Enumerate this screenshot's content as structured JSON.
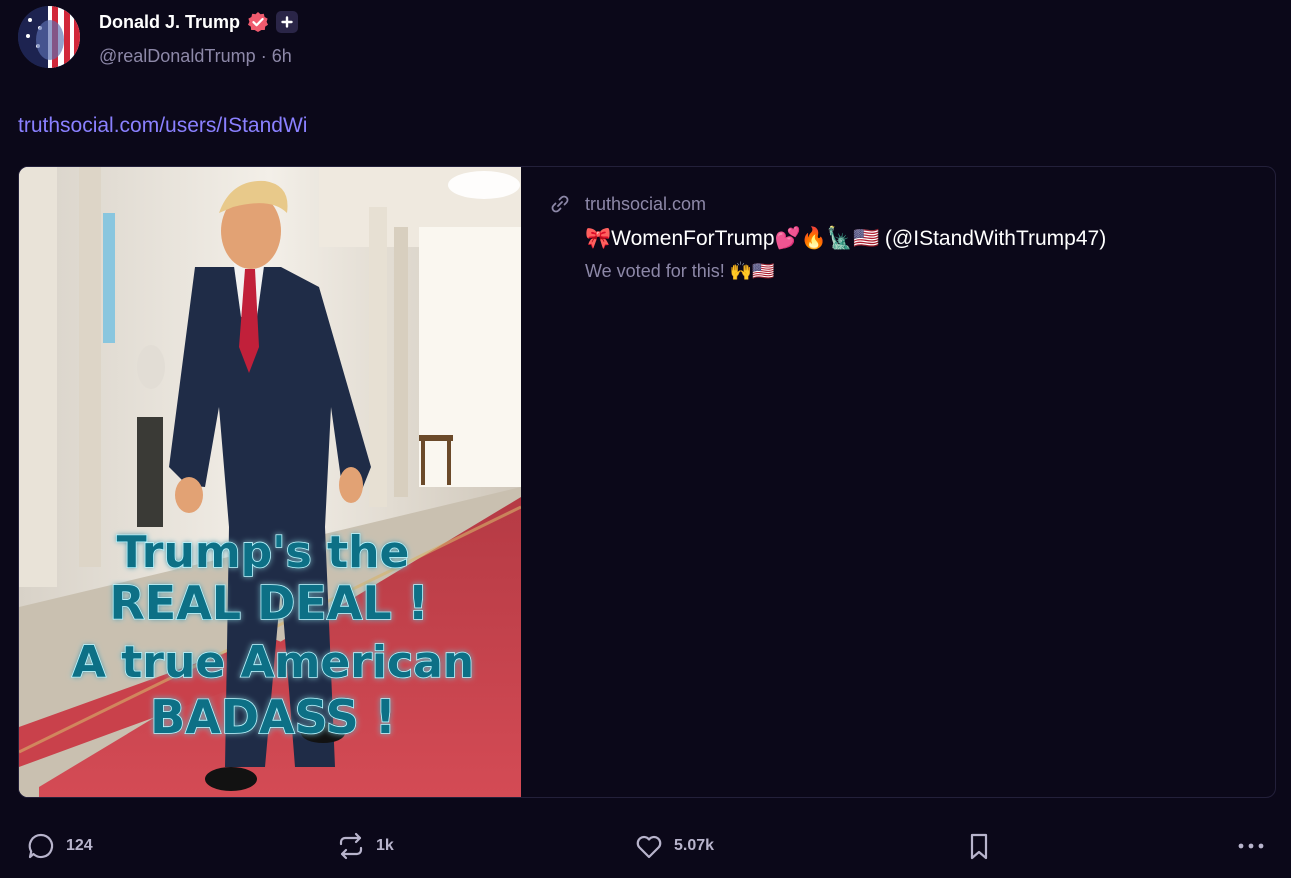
{
  "author": {
    "display_name": "Donald J. Trump",
    "handle": "@realDonaldTrump",
    "separator": "·",
    "time_ago": "6h",
    "verified_icon": "verified-check-icon",
    "plus_icon": "plus-icon"
  },
  "post": {
    "link_text": "truthsocial.com/users/IStandWi"
  },
  "card": {
    "domain": "truthsocial.com",
    "title": "🎀WomenForTrump💕🔥🗽🇺🇸 (@IStandWithTrump47)",
    "description": "We voted for this! 🙌🇺🇸",
    "image_text": {
      "line1": "Trump's the",
      "line2": "REAL DEAL !",
      "line3": "A true American",
      "line4": "BADASS !"
    }
  },
  "actions": {
    "replies": "124",
    "retruths": "1k",
    "likes": "5.07k"
  },
  "colors": {
    "background": "#0b0819",
    "link": "#8a80ff",
    "muted": "#8d88a8",
    "verified": "#f05a6e",
    "carpet": "#c9414b"
  }
}
